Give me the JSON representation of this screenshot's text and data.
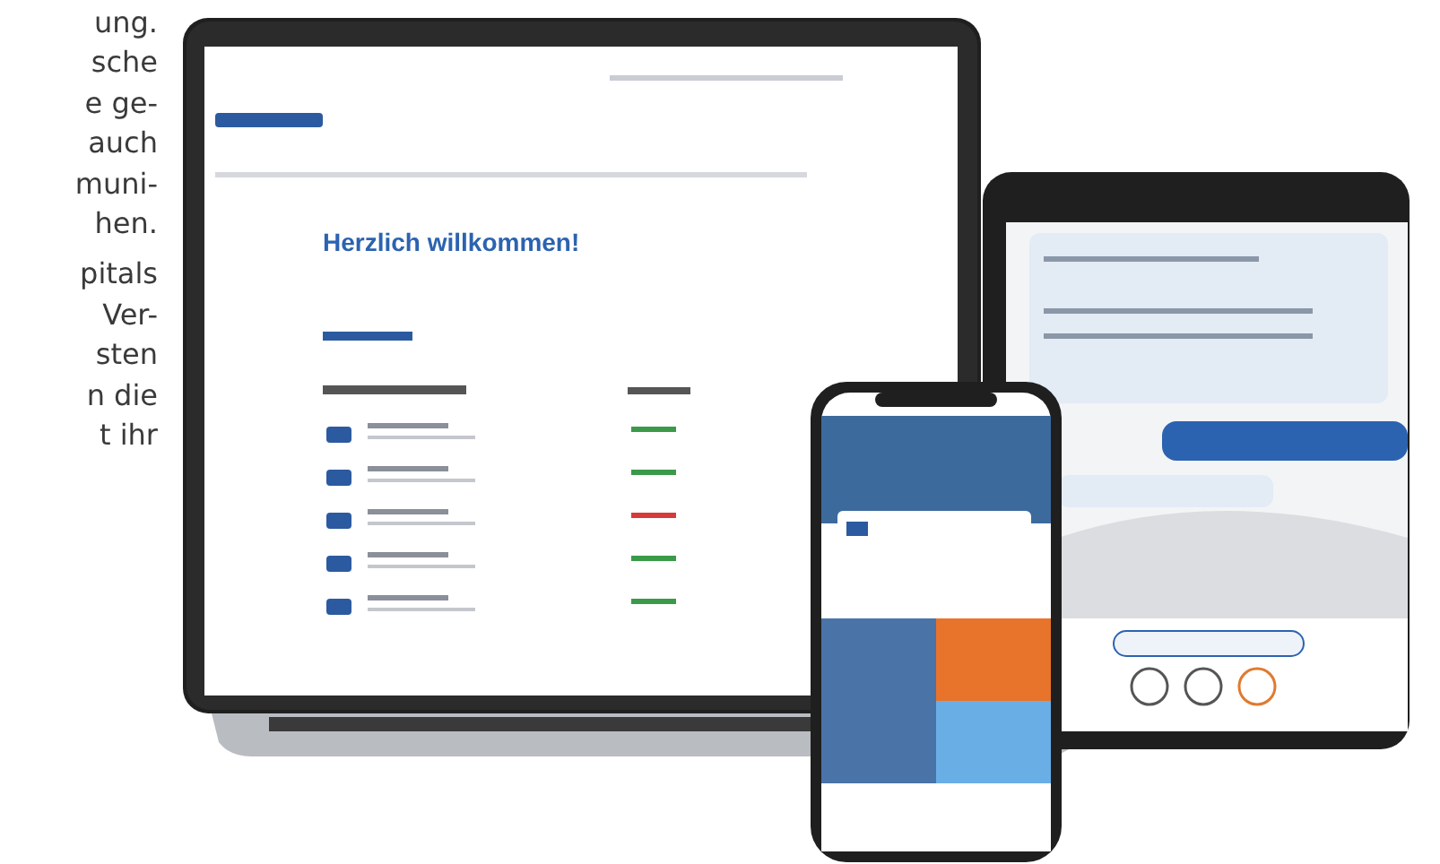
{
  "intro_text": {
    "paragraphs": [
      [
        "ung.",
        "sche",
        "e ge-",
        "auch",
        "muni-",
        "hen."
      ],
      [
        "pitals",
        "Ver-",
        "sten",
        "n die",
        "t ihr"
      ]
    ]
  },
  "laptop_screen": {
    "heading": "Herzlich willkommen!"
  }
}
